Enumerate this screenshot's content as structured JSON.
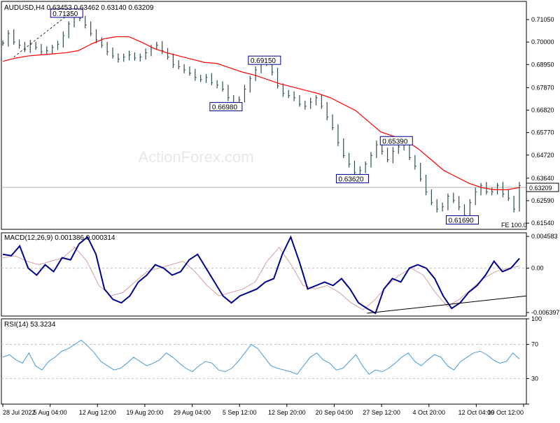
{
  "chart_data": {
    "type": "line",
    "symbol_header": "AUDUSD,H4  0.63453  0.63462  0.63140  0.63209",
    "watermark": "ActionForex.com",
    "current_price_label": "0.63209",
    "current_price": 0.63209,
    "fe_label": "FE 100.0",
    "x_tick_labels": [
      "28 Jul 2022",
      "5 Aug 04:00",
      "12 Aug 12:00",
      "19 Aug 20:00",
      "29 Aug 04:00",
      "5 Sep 12:00",
      "12 Sep 20:00",
      "20 Sep 04:00",
      "27 Sep 12:00",
      "4 Oct 20:00",
      "12 Oct 04:00",
      "19 Oct 12:00"
    ],
    "panels": [
      {
        "name": "price",
        "ylim": [
          0.6125,
          0.719
        ],
        "y_tick_labels": [
          "0.71050",
          "0.70000",
          "0.68950",
          "0.67870",
          "0.66820",
          "0.65770",
          "0.64720",
          "0.63640",
          "0.62590",
          "0.61540"
        ],
        "y_tick_values": [
          0.7105,
          0.7,
          0.6895,
          0.6787,
          0.6682,
          0.6577,
          0.6472,
          0.6364,
          0.6259,
          0.6154
        ],
        "price_series": [
          0.6995,
          0.704,
          0.7,
          0.6985,
          0.6965,
          0.699,
          0.6975,
          0.6955,
          0.696,
          0.6975,
          0.699,
          0.703,
          0.7085,
          0.7115,
          0.711,
          0.708,
          0.704,
          0.701,
          0.6985,
          0.6955,
          0.6935,
          0.692,
          0.693,
          0.694,
          0.6925,
          0.693,
          0.695,
          0.6975,
          0.6985,
          0.696,
          0.693,
          0.6895,
          0.6885,
          0.687,
          0.6855,
          0.6835,
          0.6825,
          0.6835,
          0.681,
          0.68,
          0.678,
          0.674,
          0.671,
          0.673,
          0.678,
          0.683,
          0.687,
          0.69,
          0.691,
          0.686,
          0.6795,
          0.676,
          0.675,
          0.674,
          0.671,
          0.67,
          0.672,
          0.674,
          0.67,
          0.665,
          0.66,
          0.653,
          0.647,
          0.643,
          0.639,
          0.64,
          0.643,
          0.647,
          0.652,
          0.649,
          0.645,
          0.649,
          0.651,
          0.652,
          0.646,
          0.642,
          0.636,
          0.63,
          0.625,
          0.622,
          0.623,
          0.628,
          0.626,
          0.623,
          0.619,
          0.625,
          0.63,
          0.633,
          0.63,
          0.63,
          0.633,
          0.629,
          0.627,
          0.622,
          0.633
        ],
        "ma_series": [
          0.691,
          0.6925,
          0.6935,
          0.694,
          0.6945,
          0.695,
          0.696,
          0.699,
          0.7015,
          0.7025,
          0.7025,
          0.7,
          0.697,
          0.695,
          0.6935,
          0.692,
          0.6905,
          0.69,
          0.688,
          0.686,
          0.6845,
          0.6825,
          0.6805,
          0.679,
          0.6775,
          0.676,
          0.674,
          0.671,
          0.668,
          0.663,
          0.658,
          0.656,
          0.654,
          0.65,
          0.645,
          0.64,
          0.637,
          0.634,
          0.632,
          0.631,
          0.631,
          0.632
        ],
        "annotations": [
          {
            "label": "0.71350",
            "value": 0.7135
          },
          {
            "label": "0.69150",
            "value": 0.6915
          },
          {
            "label": "0.66980",
            "value": 0.6698
          },
          {
            "label": "0.65390",
            "value": 0.6539
          },
          {
            "label": "0.63620",
            "value": 0.6362
          },
          {
            "label": "0.61690",
            "value": 0.6169
          }
        ]
      },
      {
        "name": "MACD(12,26,9) 0.001386 0.000314",
        "ylim": [
          -0.0069,
          0.0051
        ],
        "y_tick_labels": [
          "0.004583",
          "0.00",
          "-0.006397"
        ],
        "y_tick_values": [
          0.004583,
          0.0,
          -0.006397
        ],
        "macd_series": [
          0.002,
          0.0018,
          0.0032,
          0.0,
          -0.001,
          0.0005,
          -0.0005,
          0.0015,
          0.0012,
          0.0035,
          0.0045,
          0.002,
          -0.003,
          -0.0045,
          -0.005,
          -0.004,
          -0.002,
          -0.001,
          0.0005,
          0.0,
          -0.001,
          -0.0005,
          0.0012,
          0.002,
          0.0,
          -0.002,
          -0.004,
          -0.005,
          -0.004,
          -0.0035,
          -0.003,
          -0.002,
          -0.0015,
          0.002,
          0.0045,
          0.001,
          -0.003,
          -0.0025,
          -0.002,
          -0.0025,
          -0.0015,
          -0.003,
          -0.005,
          -0.0058,
          -0.0065,
          -0.003,
          -0.0015,
          -0.002,
          0.0,
          0.0005,
          0.0,
          -0.0015,
          -0.004,
          -0.0058,
          -0.005,
          -0.0035,
          -0.0025,
          -0.001,
          0.001,
          -0.0005,
          0.0,
          0.0014
        ],
        "signal_series": [
          0.0015,
          0.0018,
          0.001,
          0.0005,
          0.001,
          0.0015,
          0.003,
          0.001,
          -0.0025,
          -0.004,
          -0.0035,
          -0.002,
          -0.0005,
          0.0,
          0.0005,
          0.001,
          -0.0005,
          -0.0025,
          -0.004,
          -0.0035,
          -0.003,
          -0.002,
          0.001,
          0.003,
          0.0005,
          -0.0025,
          -0.003,
          -0.0025,
          -0.0035,
          -0.005,
          -0.006,
          -0.0045,
          -0.0025,
          -0.001,
          0.0,
          -0.001,
          -0.0035,
          -0.0055,
          -0.0045,
          -0.003,
          -0.0015,
          -0.0005,
          0.0,
          0.0003
        ]
      },
      {
        "name": "RSI(14) 53.3234",
        "ylim": [
          0,
          100
        ],
        "y_tick_labels": [
          "100",
          "70",
          "30",
          "0"
        ],
        "y_tick_values": [
          100,
          70,
          30,
          0
        ],
        "rsi_series": [
          55,
          58,
          52,
          48,
          60,
          45,
          40,
          50,
          55,
          62,
          65,
          70,
          75,
          68,
          60,
          50,
          45,
          40,
          42,
          48,
          55,
          50,
          45,
          48,
          52,
          60,
          55,
          48,
          42,
          38,
          45,
          50,
          48,
          40,
          38,
          42,
          50,
          60,
          70,
          65,
          55,
          45,
          42,
          40,
          38,
          35,
          45,
          55,
          60,
          52,
          48,
          40,
          42,
          50,
          58,
          45,
          35,
          40,
          38,
          42,
          48,
          55,
          60,
          50,
          45,
          52,
          58,
          55,
          45,
          40,
          50,
          55,
          60,
          62,
          58,
          52,
          48,
          50,
          60,
          53
        ]
      }
    ],
    "colors": {
      "price_bars": "#2f4f4f",
      "moving_average": "#ff0000",
      "macd_line": "#00008b",
      "signal_line": "#d2a0a0",
      "rsi_line": "#4a9ad8",
      "trendline": "#000000",
      "annotation_border": "#00008b",
      "watermark": "#e8e8e8"
    }
  }
}
